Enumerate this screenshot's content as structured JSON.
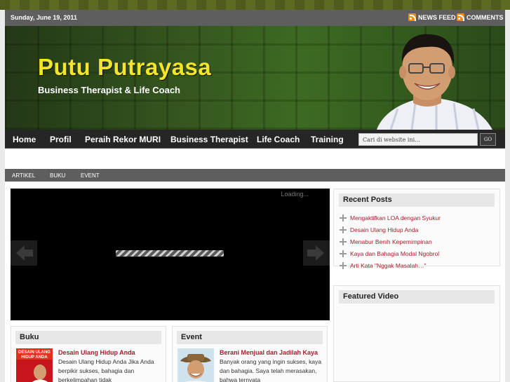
{
  "topbar": {
    "date": "Sunday, June 19, 2011",
    "news_feed": "NEWS FEED",
    "comments": "COMMENTS"
  },
  "header": {
    "title": "Putu Putrayasa",
    "tagline": "Business Therapist & Life Coach"
  },
  "nav": {
    "items": [
      "Home",
      "Profil",
      "Peraih Rekor MURI",
      "Business Therapist",
      "Life Coach",
      "Training"
    ],
    "search_placeholder": "Cari di website ini...",
    "search_button": "GO"
  },
  "subnav": {
    "items": [
      "ARTIKEL",
      "BUKU",
      "EVENT"
    ]
  },
  "slider": {
    "loading_text": "Loading..."
  },
  "recent_posts": {
    "title": "Recent Posts",
    "items": [
      "Mengaktifkan LOA dengan Syukur",
      "Desain Ulang Hidup Anda",
      "Menabur Benih Kepemimpinan",
      "Kaya dan Bahagia Modal Ngobrol",
      "Arti Kata \"Nggak Masalah…\""
    ]
  },
  "featured_video": {
    "title": "Featured Video"
  },
  "buku": {
    "title": "Buku",
    "item_title": "Desain Ulang Hidup Anda",
    "item_text": "Desain Ulang Hidup Anda Jika Anda berpikir sukses, bahagia dan berkelimpahan tidak",
    "cover_text": "DESAIN ULANG HIDUP ANDA"
  },
  "event": {
    "title": "Event",
    "item_title": "Berani Menjual dan Jadilah Kaya",
    "item_text": "Banyak orang yang ingin sukses, kaya dan bahagia. Saya telah merasakan, bahwa ternyata"
  },
  "colors": {
    "accent_link": "#a31d2c",
    "title_yellow": "#f3e52a",
    "bar_gray": "#5e5e5e",
    "nav_dark": "#262626",
    "rss_orange": "#f08a1c"
  }
}
